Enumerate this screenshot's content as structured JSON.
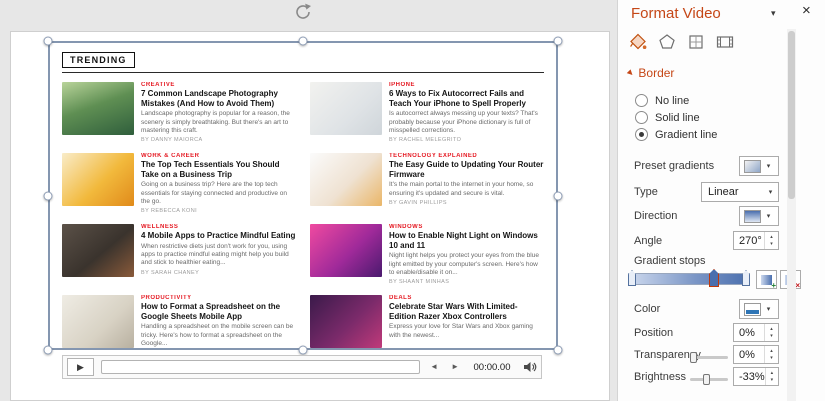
{
  "colors": {
    "accent": "#c54717",
    "category_red": "#e51b24",
    "selection_border": "#8496b0",
    "gradient_bar_start": "#cdd9ee",
    "gradient_bar_end": "#4a6fae"
  },
  "pane": {
    "title": "Format Video",
    "collapse_icon": "▾",
    "close_icon": "×",
    "tabs": [
      {
        "name": "Fill & Line"
      },
      {
        "name": "Effects"
      },
      {
        "name": "Size & Properties"
      },
      {
        "name": "Video"
      }
    ],
    "border": {
      "label": "Border",
      "radio_no": "No line",
      "radio_solid": "Solid line",
      "radio_gradient": "Gradient line",
      "preset_label": "Preset gradients",
      "type_label": "Type",
      "type_value": "Linear",
      "direction_label": "Direction",
      "angle_label": "Angle",
      "angle_value": "270°",
      "stops_label": "Gradient stops",
      "color_label": "Color",
      "position_label": "Position",
      "position_value": "0%",
      "transparency_label": "Transparency",
      "transparency_value": "0%",
      "brightness_label": "Brightness",
      "brightness_value": "-33%"
    },
    "ui": {
      "dropdown_arrow": "▾",
      "spin_up": "▴",
      "spin_down": "▾",
      "add_stop_glyph": "+",
      "remove_stop_glyph": "×"
    }
  },
  "video": {
    "trending": "TRENDING",
    "articles": [
      {
        "category": "CREATIVE",
        "title": "7 Common Landscape Photography Mistakes (And How to Avoid Them)",
        "desc": "Landscape photography is popular for a reason, the scenery is simply breathtaking. But there's an art to mastering this craft.",
        "byline": "BY DANNY MAIORCA"
      },
      {
        "category": "IPHONE",
        "title": "6 Ways to Fix Autocorrect Fails and Teach Your iPhone to Spell Properly",
        "desc": "Is autocorrect always messing up your texts? That's probably because your iPhone dictionary is full of misspelled corrections.",
        "byline": "BY RACHEL MELEGRITO"
      },
      {
        "category": "WORK & CAREER",
        "title": "The Top Tech Essentials You Should Take on a Business Trip",
        "desc": "Going on a business trip? Here are the top tech essentials for staying connected and productive on the go.",
        "byline": "BY REBECCA KONI"
      },
      {
        "category": "TECHNOLOGY EXPLAINED",
        "title": "The Easy Guide to Updating Your Router Firmware",
        "desc": "It's the main portal to the internet in your home, so ensuring it's updated and secure is vital.",
        "byline": "BY GAVIN PHILLIPS"
      },
      {
        "category": "WELLNESS",
        "title": "4 Mobile Apps to Practice Mindful Eating",
        "desc": "When restrictive diets just don't work for you, using apps to practice mindful eating might help you build and stick to healthier eating...",
        "byline": "BY SARAH CHANEY"
      },
      {
        "category": "WINDOWS",
        "title": "How to Enable Night Light on Windows 10 and 11",
        "desc": "Night light helps you protect your eyes from the blue light emitted by your computer's screen. Here's how to enable/disable it on...",
        "byline": "BY SHAANT MINHAS"
      },
      {
        "category": "PRODUCTIVITY",
        "title": "How to Format a Spreadsheet on the Google Sheets Mobile App",
        "desc": "Handling a spreadsheet on the mobile screen can be tricky. Here's how to format a spreadsheet on the Google...",
        "byline": ""
      },
      {
        "category": "DEALS",
        "title": "Celebrate Star Wars With Limited-Edition Razer Xbox Controllers",
        "desc": "Express your love for Star Wars and Xbox gaming with the newest...",
        "byline": ""
      }
    ]
  },
  "player": {
    "play": "▶",
    "back": "◄",
    "forward": "►",
    "time": "00:00.00"
  }
}
